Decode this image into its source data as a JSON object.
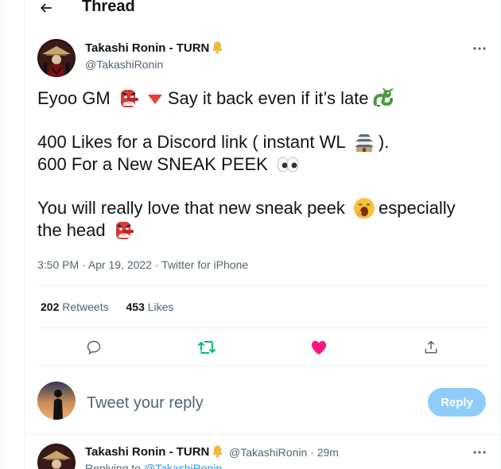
{
  "header": {
    "back_icon": "arrow-left-icon",
    "title": "Thread"
  },
  "tweet": {
    "author_name": "Takashi Ronin - TURN",
    "author_handle": "@TakashiRonin",
    "badge_icon": "bell-icon",
    "more_icon": "more-horizontal-icon",
    "lines": {
      "l1_a": "Eyoo GM ",
      "l1_b": "Say it back even if it’s late",
      "l2_a": "400 Likes for a Discord link ( instant WL ",
      "l2_b": ").",
      "l3_a": "600 For a New SNEAK PEEK ",
      "l4_a": "You will really love that new sneak peek ",
      "l4_b": "especially",
      "l5_a": "the head "
    },
    "emojis": [
      "tengu-mask-emoji",
      "red-down-triangle-emoji",
      "dragon-emoji",
      "japanese-castle-emoji",
      "eyes-emoji",
      "yawning-face-emoji",
      "tengu-mask-emoji"
    ],
    "timestamp": "3:50 PM · Apr 19, 2022 · ",
    "source": "Twitter for iPhone",
    "retweets_count": "202",
    "retweets_label": "Retweets",
    "likes_count": "453",
    "likes_label": "Likes",
    "actions": {
      "reply_icon": "reply-bubble-icon",
      "retweet_icon": "retweet-icon",
      "like_icon": "heart-filled-icon",
      "share_icon": "share-icon"
    },
    "colors": {
      "retweet_green": "#00ba7c",
      "like_pink": "#f91880",
      "link_blue": "#1d9bf0"
    }
  },
  "reply_box": {
    "placeholder": "Tweet your reply",
    "button_label": "Reply",
    "button_color": "#8ecdf8"
  },
  "next_tweet": {
    "author_name": "Takashi Ronin - TURN",
    "handle_time": "@TakashiRonin · 29m",
    "replying_prefix": "Replying to ",
    "replying_to": "@TakashiRonin"
  }
}
